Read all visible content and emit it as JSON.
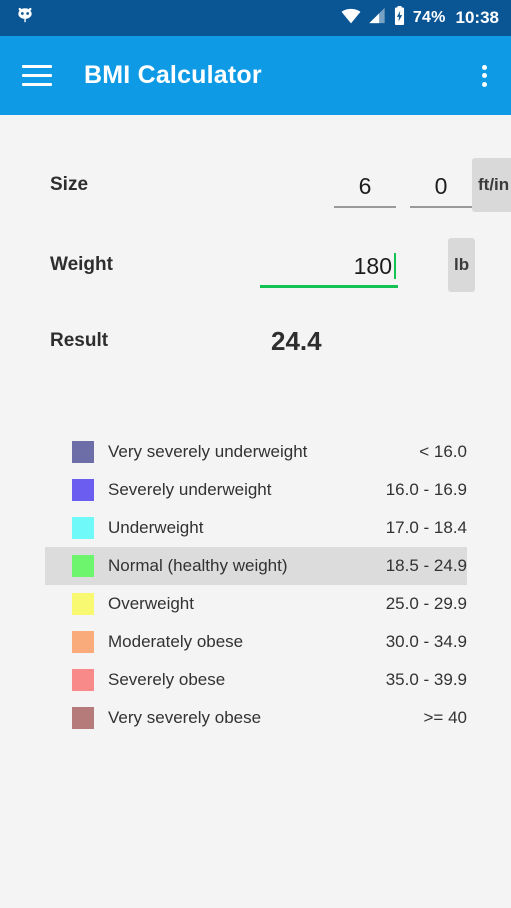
{
  "status_bar": {
    "logo_icon": "cyanogenmod-logo-icon",
    "wifi_icon": "wifi-icon",
    "signal_icon": "cell-signal-icon",
    "battery_icon": "battery-charging-icon",
    "battery_percent": "74%",
    "clock": "10:38",
    "background": "#0a5694"
  },
  "app_bar": {
    "menu_icon": "hamburger-menu-icon",
    "title": "BMI Calculator",
    "overflow_icon": "overflow-menu-icon",
    "background": "#0f9ae5"
  },
  "form": {
    "size": {
      "label": "Size",
      "feet_value": "6",
      "inches_value": "0",
      "unit_button": "ft/in"
    },
    "weight": {
      "label": "Weight",
      "value": "180",
      "unit_button": "lb",
      "focused": true,
      "focus_color": "#12c252"
    },
    "result": {
      "label": "Result",
      "value": "24.4"
    }
  },
  "legend": {
    "active_index": 3,
    "active_background": "#dcdcdc",
    "rows": [
      {
        "color": "#6d6da8",
        "label": "Very severely underweight",
        "range": "< 16.0"
      },
      {
        "color": "#6a5df0",
        "label": "Severely underweight",
        "range": "16.0 - 16.9"
      },
      {
        "color": "#6ff9f9",
        "label": "Underweight",
        "range": "17.0 - 18.4"
      },
      {
        "color": "#6ef56e",
        "label": "Normal (healthy weight)",
        "range": "18.5 - 24.9"
      },
      {
        "color": "#f8f871",
        "label": "Overweight",
        "range": "25.0 - 29.9"
      },
      {
        "color": "#f9ab7c",
        "label": "Moderately obese",
        "range": "30.0 - 34.9"
      },
      {
        "color": "#f98a8a",
        "label": "Severely obese",
        "range": "35.0 - 39.9"
      },
      {
        "color": "#b57a7a",
        "label": "Very severely obese",
        "range": ">= 40"
      }
    ]
  }
}
